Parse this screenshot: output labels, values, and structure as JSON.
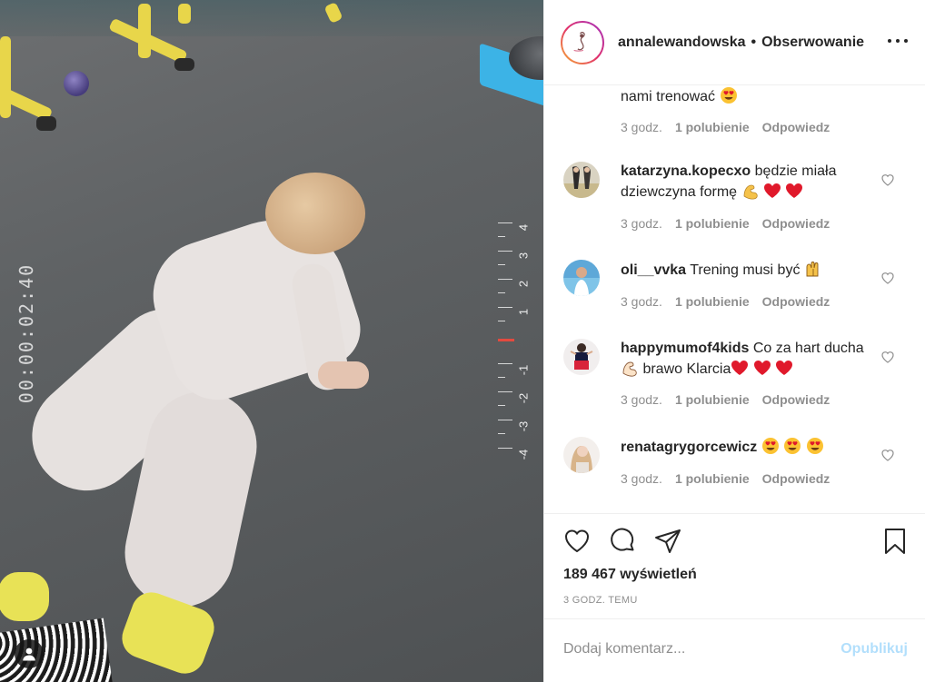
{
  "media": {
    "timer_text": "00:00:02:40",
    "ruler_labels": [
      "4",
      "3",
      "2",
      "1",
      "-1",
      "-2",
      "-3",
      "-4"
    ]
  },
  "header": {
    "username": "annalewandowska",
    "separator": "•",
    "follow_label": "Obserwowanie"
  },
  "comments": {
    "top_partial": {
      "text": "nami trenować",
      "time": "3 godz.",
      "likes": "1 polubienie",
      "reply": "Odpowiedz"
    },
    "items": [
      {
        "username": "katarzyna.kopecxo",
        "text": "będzie miała dziewczyna formę",
        "time": "3 godz.",
        "likes": "1 polubienie",
        "reply": "Odpowiedz"
      },
      {
        "username": "oli__vvka",
        "text": "Trening musi być",
        "time": "3 godz.",
        "likes": "1 polubienie",
        "reply": "Odpowiedz"
      },
      {
        "username": "happymumof4kids",
        "text": "Co za hart ducha",
        "text2": "brawo Klarcia",
        "time": "3 godz.",
        "likes": "1 polubienie",
        "reply": "Odpowiedz"
      },
      {
        "username": "renatagrygorcewicz",
        "text": "",
        "time": "3 godz.",
        "likes": "1 polubienie",
        "reply": "Odpowiedz"
      }
    ]
  },
  "actions": {
    "views": "189 467 wyświetleń",
    "time_ago": "3 GODZ. TEMU"
  },
  "add_comment": {
    "placeholder": "Dodaj komentarz...",
    "publish_label": "Opublikuj"
  },
  "icons": {
    "like": "heart-icon",
    "comment": "comment-icon",
    "share": "paper-plane-icon",
    "save": "bookmark-icon",
    "more": "more-dots-icon"
  },
  "colors": {
    "text": "#262626",
    "secondary": "#8e8e8e",
    "publish_disabled": "#b2dffc",
    "border": "#efefef",
    "heart_red": "#e0192b"
  }
}
